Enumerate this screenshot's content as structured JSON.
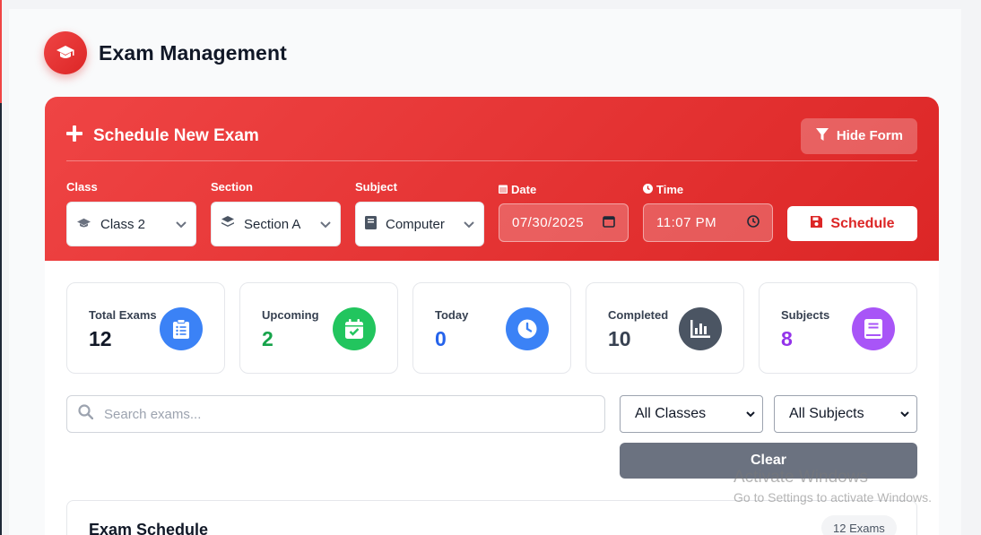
{
  "app": {
    "title": "Exam Management"
  },
  "form": {
    "title": "Schedule New Exam",
    "toggle_label": "Hide Form",
    "fields": {
      "class": {
        "label": "Class",
        "value": "Class 2"
      },
      "section": {
        "label": "Section",
        "value": "Section A"
      },
      "subject": {
        "label": "Subject",
        "value": "Computer"
      },
      "date": {
        "label": "Date",
        "value": "07/30/2025"
      },
      "time": {
        "label": "Time",
        "value": "11:07 PM"
      }
    },
    "submit_label": "Schedule"
  },
  "stats": [
    {
      "label": "Total Exams",
      "value": "12",
      "color": "#111827",
      "icon": "clipboard-list-icon",
      "icon_bg": "#3b82f6"
    },
    {
      "label": "Upcoming",
      "value": "2",
      "color": "#16a34a",
      "icon": "calendar-check-icon",
      "icon_bg": "#22c55e"
    },
    {
      "label": "Today",
      "value": "0",
      "color": "#2563eb",
      "icon": "clock-icon",
      "icon_bg": "#3b82f6"
    },
    {
      "label": "Completed",
      "value": "10",
      "color": "#374151",
      "icon": "chart-bar-icon",
      "icon_bg": "#4b5563"
    },
    {
      "label": "Subjects",
      "value": "8",
      "color": "#9333ea",
      "icon": "book-icon",
      "icon_bg": "#a855f7"
    }
  ],
  "filters": {
    "search_placeholder": "Search exams...",
    "class_filter": "All Classes",
    "subject_filter": "All Subjects",
    "clear_label": "Clear"
  },
  "schedule": {
    "title": "Exam Schedule",
    "count_label": "12 Exams"
  },
  "watermark": {
    "title": "Activate Windows",
    "subtitle": "Go to Settings to activate Windows."
  },
  "colors": {
    "primary": "#dc2626",
    "primary_light": "#ef4444"
  }
}
